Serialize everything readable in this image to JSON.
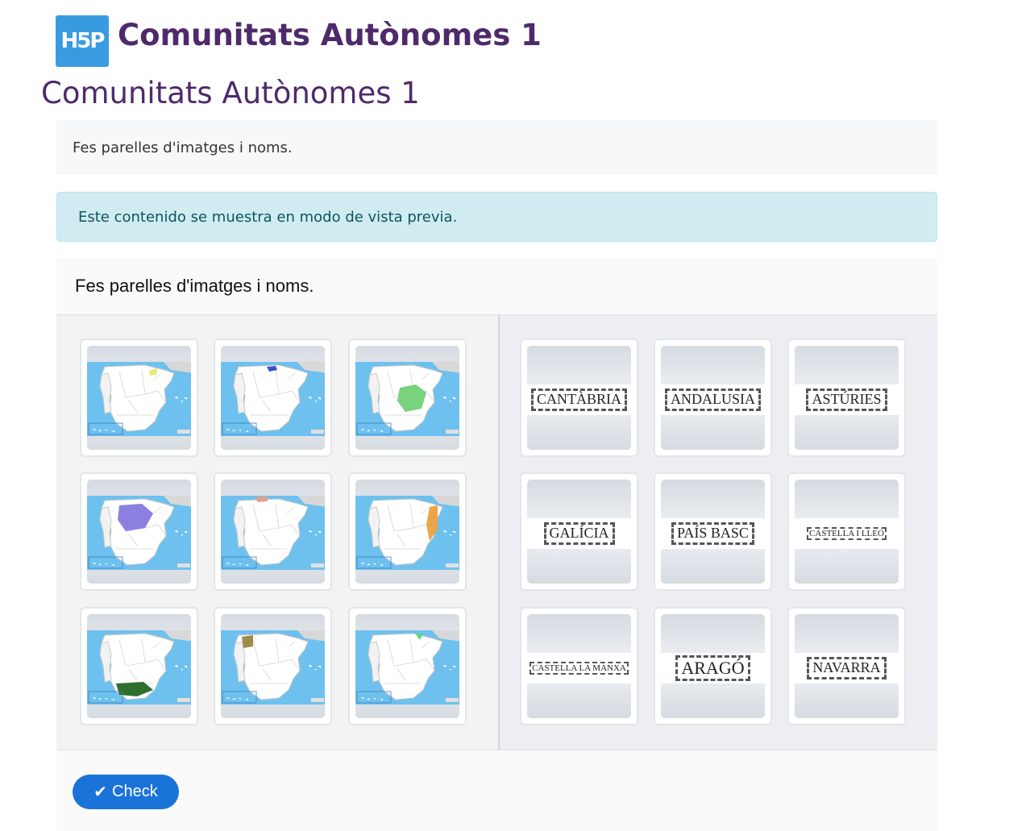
{
  "header": {
    "logo_text": "H5P",
    "title": "Comunitats Autònomes 1"
  },
  "page": {
    "title": "Comunitats Autònomes 1"
  },
  "intro": {
    "text": "Fes parelles d'imatges i noms."
  },
  "alert": {
    "text": "Este contenido se muestra en modo de vista previa."
  },
  "activity": {
    "task": "Fes parelles d'imatges i noms.",
    "check_label": "Check",
    "colors": {
      "sea": "#6ec1ee",
      "land": "#ffffff",
      "border": "#c8c8c8",
      "button": "#1a73d9"
    },
    "image_cards": [
      {
        "region": "cantabria-map",
        "highlight": "#e8e87a"
      },
      {
        "region": "pais-basc-map",
        "highlight": "#3b4fd1"
      },
      {
        "region": "castella-la-manxa-map",
        "highlight": "#79d27c"
      },
      {
        "region": "castella-i-lleo-map",
        "highlight": "#8b80e0"
      },
      {
        "region": "navarra-map",
        "highlight": "#e8a08a"
      },
      {
        "region": "arago-map",
        "highlight": "#eba54a"
      },
      {
        "region": "andalusia-map",
        "highlight": "#2f6e2f"
      },
      {
        "region": "asturies-map",
        "highlight": "#a08c4a"
      },
      {
        "region": "galicia-map",
        "highlight": "#5cd77a"
      }
    ],
    "name_cards": [
      {
        "label": "CANTÀBRIA",
        "size": 18
      },
      {
        "label": "ANDALUSIA",
        "size": 18
      },
      {
        "label": "ASTÚRIES",
        "size": 18
      },
      {
        "label": "GALÍCIA",
        "size": 18
      },
      {
        "label": "PAÍS BASC",
        "size": 18
      },
      {
        "label": "CASTELLA I LLEÓ",
        "size": 11
      },
      {
        "label": "CASTELLA LA MANXA",
        "size": 11
      },
      {
        "label": "ARAGÓ",
        "size": 22
      },
      {
        "label": "NAVARRA",
        "size": 18
      }
    ]
  }
}
